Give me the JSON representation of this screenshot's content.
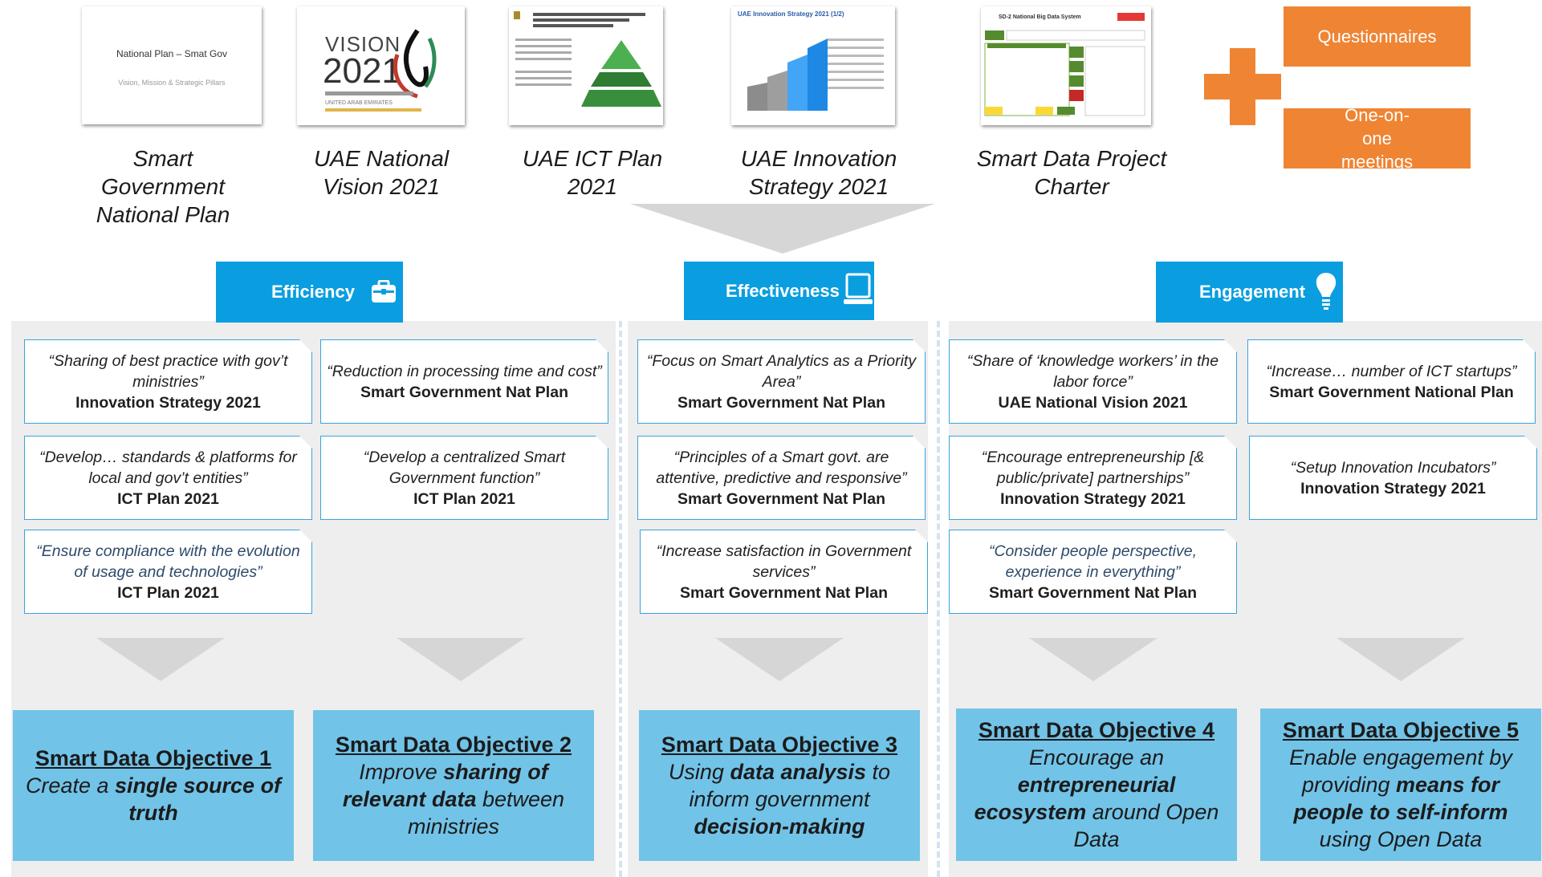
{
  "sources": [
    {
      "label": "Smart Government National Plan",
      "thumb_title": "National Plan – Smat Gov",
      "thumb_sub": "Vision, Mission & Strategic Pillars"
    },
    {
      "label": "UAE National Vision 2021",
      "thumb_title": "VISION",
      "thumb_year": "2021",
      "thumb_sub": "UNITED ARAB EMIRATES"
    },
    {
      "label": "UAE ICT Plan 2021"
    },
    {
      "label": "UAE Innovation Strategy 2021",
      "thumb_title": "UAE Innovation Strategy 2021 (1/2)"
    },
    {
      "label": "Smart Data Project Charter",
      "thumb_title": "SD-2 National Big Data System"
    }
  ],
  "side_inputs": {
    "questionnaires": "Questionnaires",
    "meetings": "One-on-one meetings"
  },
  "themes": {
    "efficiency": "Efficiency",
    "effectiveness": "Effectiveness",
    "engagement": "Engagement"
  },
  "cards": [
    {
      "quote": "“Sharing of best practice with gov’t ministries”",
      "source": "Innovation Strategy 2021"
    },
    {
      "quote": "“Reduction in processing time and cost”",
      "source": "Smart Government Nat Plan"
    },
    {
      "quote": "“Develop… standards & platforms for local and gov’t entities”",
      "source": "ICT Plan 2021"
    },
    {
      "quote": "“Develop a centralized Smart Government function”",
      "source": "ICT Plan 2021"
    },
    {
      "quote": "“Ensure compliance with the evolution of usage and technologies”",
      "source": "ICT Plan 2021"
    },
    {
      "quote": "“Focus on Smart Analytics as a Priority Area”",
      "source": "Smart Government Nat Plan"
    },
    {
      "quote": "“Principles of a Smart govt. are attentive, predictive and responsive”",
      "source": "Smart Government Nat Plan"
    },
    {
      "quote": "“Increase satisfaction in Government services”",
      "source": "Smart Government Nat Plan"
    },
    {
      "quote": "“Share of ‘knowledge workers’ in the labor force”",
      "source": "UAE National Vision 2021"
    },
    {
      "quote": "“Increase… number of ICT startups”",
      "source": "Smart Government National Plan"
    },
    {
      "quote": "“Encourage entrepreneurship [& public/private] partnerships”",
      "source": "Innovation Strategy 2021"
    },
    {
      "quote": "“Setup Innovation Incubators”",
      "source": "Innovation Strategy 2021"
    },
    {
      "quote": "“Consider people perspective, experience in everything”",
      "source": "Smart Government Nat Plan"
    }
  ],
  "objectives": [
    {
      "title": "Smart Data Objective 1",
      "pre": "Create a ",
      "bold": "single source of truth",
      "post": ""
    },
    {
      "title": "Smart Data Objective 2",
      "pre": "Improve ",
      "bold": "sharing of relevant data",
      "post": " between ministries"
    },
    {
      "title": "Smart Data Objective 3",
      "pre": "Using ",
      "bold": "data analysis",
      "post": " to inform government ",
      "bold2": "decision-making"
    },
    {
      "title": "Smart Data Objective 4",
      "pre": "Encourage an ",
      "bold": "entrepreneurial ecosystem",
      "post": " around Open Data"
    },
    {
      "title": "Smart Data Objective 5",
      "pre": "Enable engagement by providing ",
      "bold": "means for people to self-inform",
      "post": " using Open Data"
    }
  ],
  "colors": {
    "accent_blue": "#0a9ee0",
    "objective_blue": "#72c3e8",
    "orange": "#ef8433",
    "panel_grey": "#eeeeee",
    "arrow_grey": "#d6d6d6"
  }
}
